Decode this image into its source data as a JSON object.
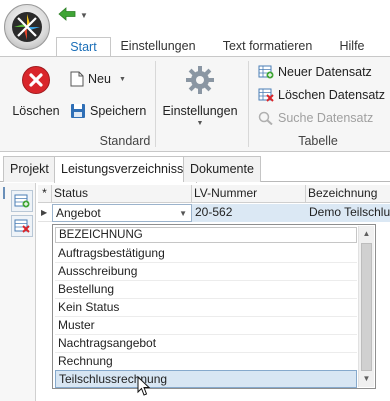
{
  "ribbon_tabs": [
    {
      "label": "Start",
      "active": true
    },
    {
      "label": "Einstellungen",
      "active": false
    },
    {
      "label": "Text formatieren",
      "active": false
    },
    {
      "label": "Hilfe",
      "active": false
    }
  ],
  "ribbon": {
    "standard": {
      "label": "Standard",
      "delete_label": "Löschen",
      "new_label": "Neu",
      "save_label": "Speichern"
    },
    "settings": {
      "label": "Einstellungen"
    },
    "table": {
      "label": "Tabelle",
      "new_record": "Neuer Datensatz",
      "delete_record": "Löschen Datensatz",
      "search_record": "Suche Datensatz"
    }
  },
  "doc_tabs": [
    {
      "label": "Projekt",
      "active": false
    },
    {
      "label": "Leistungsverzeichnisse",
      "active": true
    },
    {
      "label": "Dokumente",
      "active": false
    }
  ],
  "grid": {
    "marker": "*",
    "columns": [
      "Status",
      "LV-Nummer",
      "Bezeichnung"
    ],
    "row": {
      "status": "Angebot",
      "lv_nummer": "20-562",
      "bezeichnung": "Demo Teilschluss"
    }
  },
  "dropdown": {
    "header": "BEZEICHNUNG",
    "items": [
      "Auftragsbestätigung",
      "Ausschreibung",
      "Bestellung",
      "Kein Status",
      "Muster",
      "Nachtragsangebot",
      "Rechnung",
      "Teilschlussrechnung"
    ],
    "highlighted": "Teilschlussrechnung"
  },
  "colors": {
    "accent": "#1c6fb8",
    "delete_red": "#d9262b",
    "new_green": "#3fa535",
    "selection": "#d8e6f3"
  }
}
